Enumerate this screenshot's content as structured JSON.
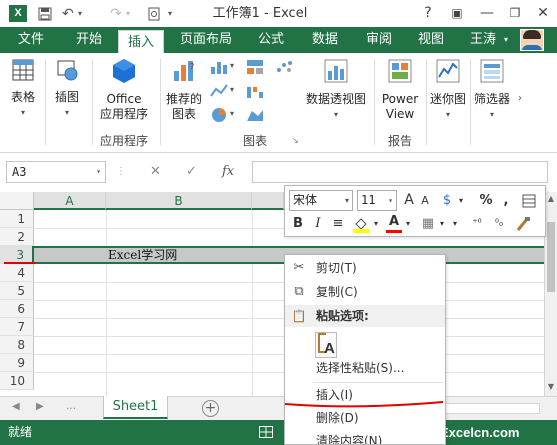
{
  "window": {
    "title": "工作簿1 - Excel",
    "app_icon": "X",
    "minimize": "—",
    "restore": "❐",
    "close": "✕",
    "help": "?",
    "ribbon_toggle": "▣"
  },
  "qat": {
    "save_icon": "floppy-icon",
    "undo_label": "↶",
    "redo_label": "↷",
    "preview_label": "▢"
  },
  "tabs": {
    "file": "文件",
    "items": [
      "开始",
      "插入",
      "页面布局",
      "公式",
      "数据",
      "审阅",
      "视图"
    ],
    "active": "插入",
    "user": "王涛"
  },
  "ribbon": {
    "table": "表格",
    "illustrations": "插图",
    "apps_line1": "Office",
    "apps_line2": "应用程序",
    "apps_group": "应用程序",
    "rec_charts_line1": "推荐的",
    "rec_charts_line2": "图表",
    "charts_group": "图表",
    "pivot_chart": "数据透视图",
    "power_view_line1": "Power",
    "power_view_line2": "View",
    "reports_group": "报告",
    "sparklines": "迷你图",
    "filter": "筛选器"
  },
  "formula_bar": {
    "name_box": "A3",
    "cancel": "✕",
    "enter": "✓",
    "fx": "fx",
    "value": ""
  },
  "grid": {
    "columns": [
      "A",
      "B"
    ],
    "rows": [
      "1",
      "2",
      "3",
      "4",
      "5",
      "6",
      "7",
      "8",
      "9",
      "10"
    ],
    "selected_row": "3",
    "cell_b3": "Excel学习网"
  },
  "mini_toolbar": {
    "font": "宋体",
    "size": "11",
    "grow": "A",
    "shrink": "A",
    "currency": "$",
    "percent": "%",
    "comma": ",",
    "bold": "B",
    "italic": "I",
    "align": "≡",
    "fill_color": "#ffff00",
    "font_color": "#ff0000",
    "font_color_letter": "A",
    "borders": "▦",
    "inc_decimal": "⁺⁰",
    "dec_decimal": "⁰₀"
  },
  "context_menu": {
    "cut": "剪切(T)",
    "copy": "复制(C)",
    "paste_options": "粘贴选项:",
    "paste_special": "选择性粘贴(S)...",
    "insert": "插入(I)",
    "delete": "删除(D)",
    "clear": "清除内容(N)"
  },
  "sheets": {
    "tabs": [
      "Sheet1"
    ],
    "add": "+"
  },
  "status": {
    "ready": "就绪",
    "watermark": "Excelcn.com"
  },
  "colors": {
    "accent": "#217346",
    "annotation_red": "#e00000"
  }
}
